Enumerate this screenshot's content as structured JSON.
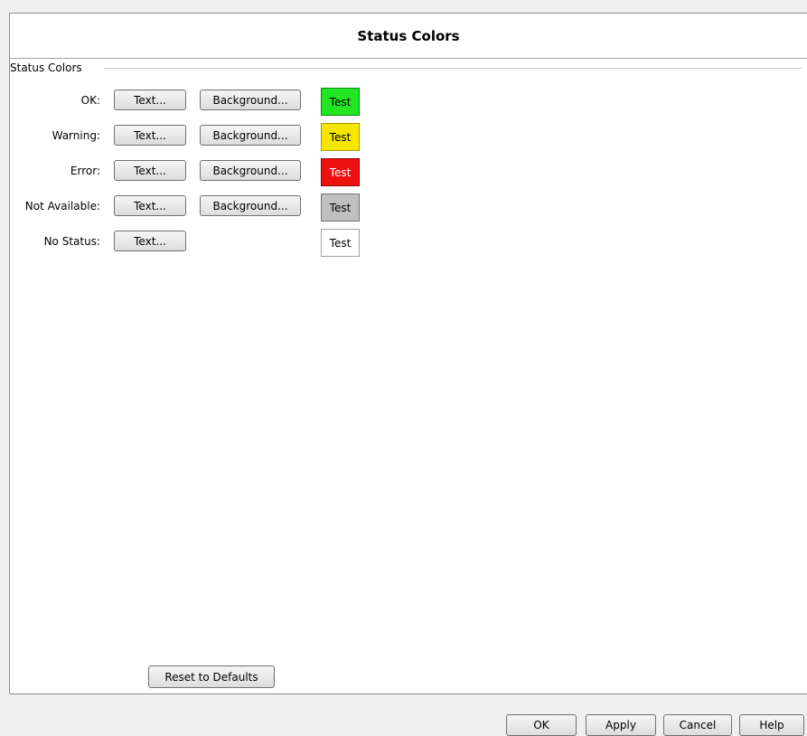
{
  "dialog": {
    "title": "Status Colors"
  },
  "group": {
    "label": "Status Colors"
  },
  "rows": [
    {
      "label": "OK:",
      "text_button": "Text...",
      "background_button": "Background...",
      "test_label": "Test",
      "test_bg": "#22e622",
      "test_fg": "#000000",
      "test_border": "#0a8a0a"
    },
    {
      "label": "Warning:",
      "text_button": "Text...",
      "background_button": "Background...",
      "test_label": "Test",
      "test_bg": "#f5e600",
      "test_fg": "#000000",
      "test_border": "#a89a00"
    },
    {
      "label": "Error:",
      "text_button": "Text...",
      "background_button": "Background...",
      "test_label": "Test",
      "test_bg": "#ee1111",
      "test_fg": "#ffffff",
      "test_border": "#9a0000"
    },
    {
      "label": "Not Available:",
      "text_button": "Text...",
      "background_button": "Background...",
      "test_label": "Test",
      "test_bg": "#c0c0c0",
      "test_fg": "#000000",
      "test_border": "#707070"
    },
    {
      "label": "No Status:",
      "text_button": "Text...",
      "test_label": "Test",
      "test_bg": "#ffffff",
      "test_fg": "#000000",
      "test_border": "#a0a0a0"
    }
  ],
  "reset_button": "Reset to Defaults",
  "footer": {
    "ok": "OK",
    "apply": "Apply",
    "cancel": "Cancel",
    "help": "Help"
  }
}
